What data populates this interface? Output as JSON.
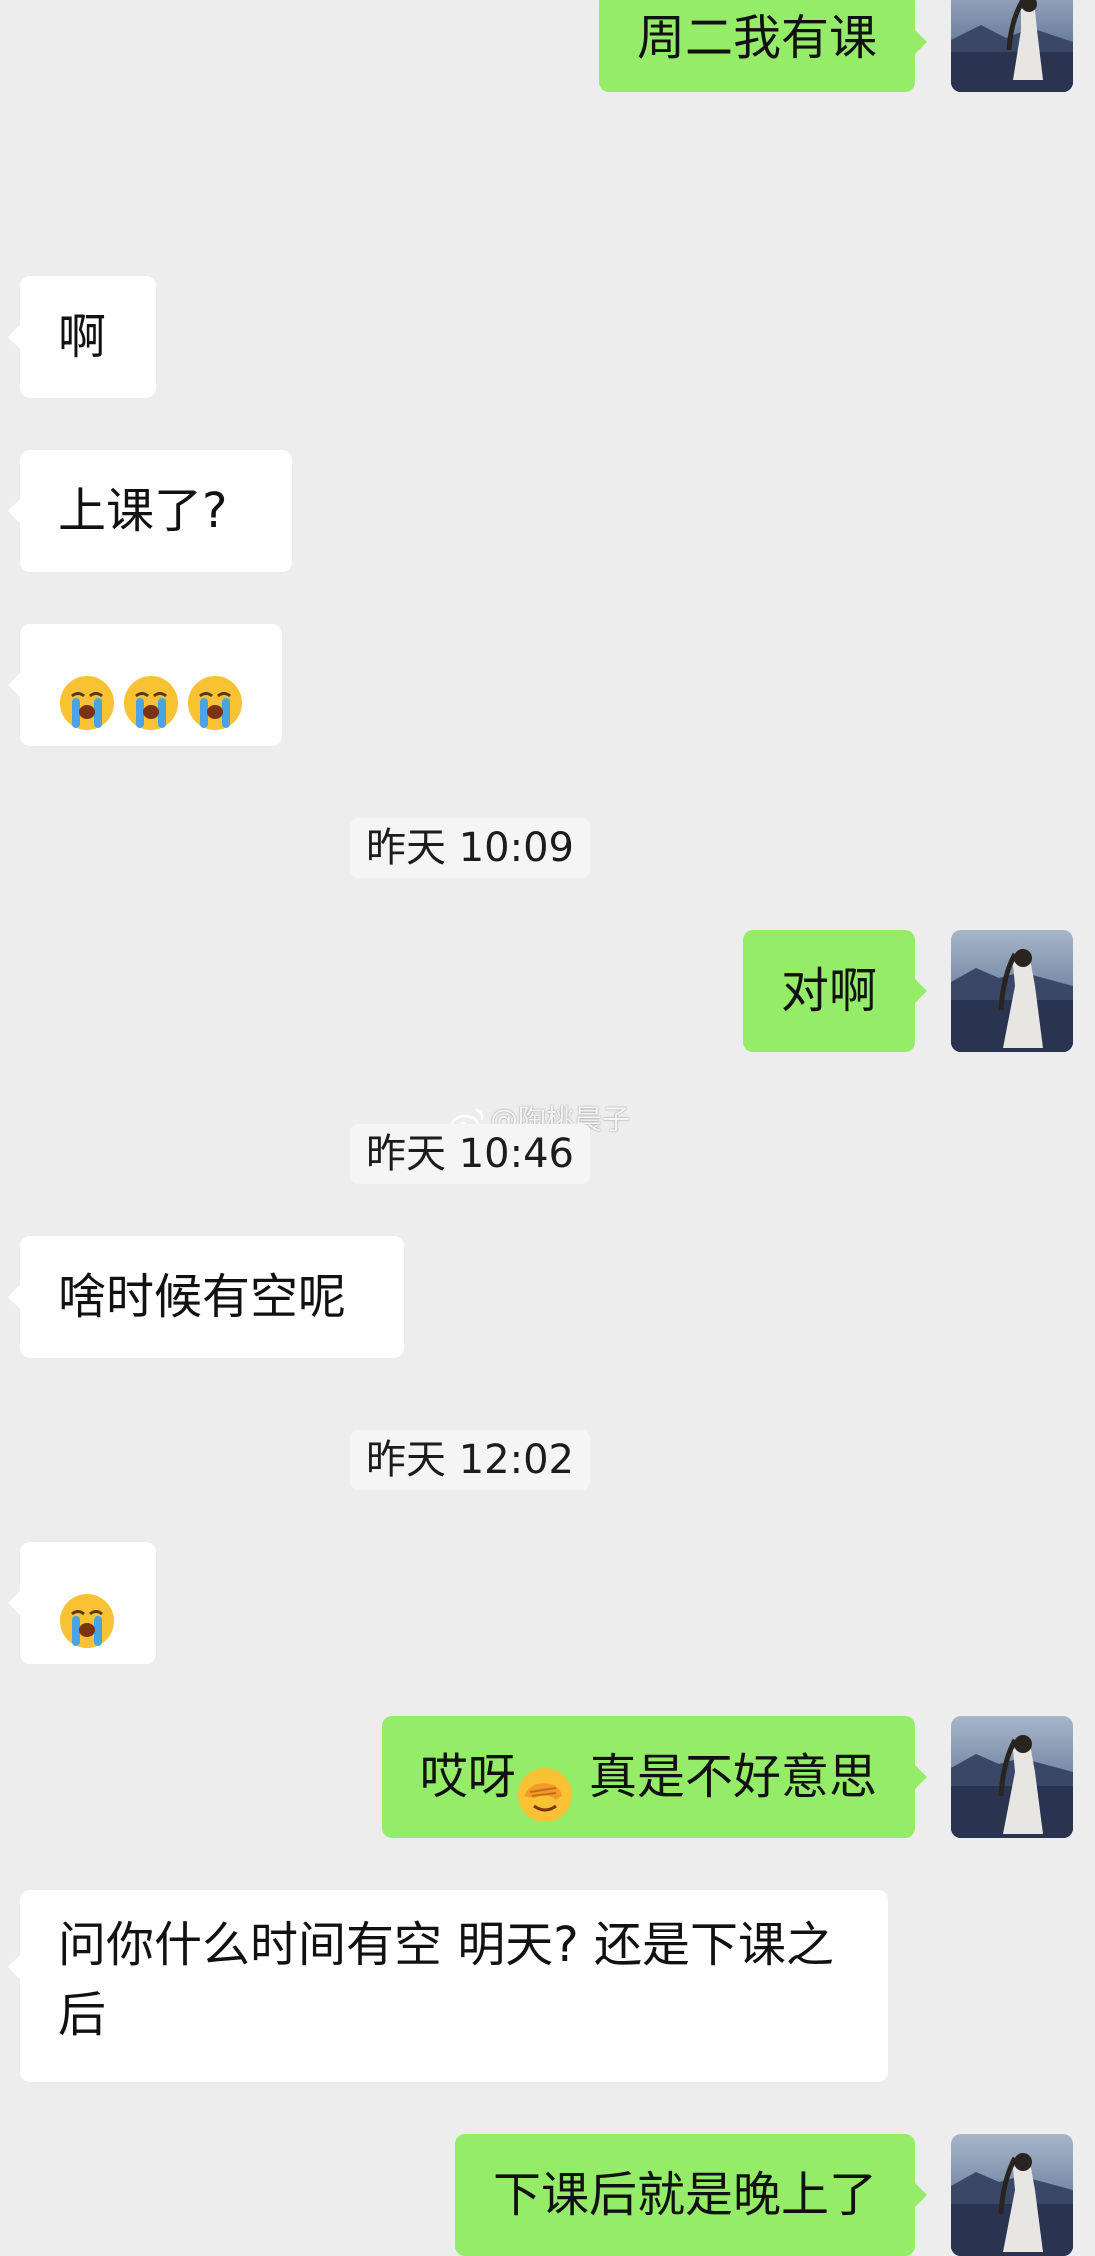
{
  "messages": [
    {
      "side": "right",
      "text": "周二我有课"
    },
    {
      "side": "left",
      "text": "啊"
    },
    {
      "side": "left",
      "text": "上课了?"
    },
    {
      "side": "left",
      "emoji": [
        "loudly-crying-face",
        "loudly-crying-face",
        "loudly-crying-face"
      ]
    },
    {
      "type": "time",
      "text": "昨天 10:09"
    },
    {
      "side": "right",
      "text": "对啊"
    },
    {
      "type": "time",
      "text": "昨天 10:46"
    },
    {
      "side": "left",
      "text": "啥时候有空呢"
    },
    {
      "type": "time",
      "text": "昨天 12:02"
    },
    {
      "side": "left",
      "emoji": [
        "loudly-crying-face"
      ]
    },
    {
      "side": "right",
      "text_before": "哎呀",
      "emoji": "face-with-hand-over-eyes",
      "text_after": " 真是不好意思"
    },
    {
      "side": "left",
      "text": "问你什么时间有空 明天? 还是下课之后"
    },
    {
      "side": "right",
      "text": "下课后就是晚上了"
    }
  ],
  "watermark": "@陶桃晨子",
  "colors": {
    "background": "#ededed",
    "sent_bubble": "#95ec69",
    "received_bubble": "#ffffff"
  }
}
